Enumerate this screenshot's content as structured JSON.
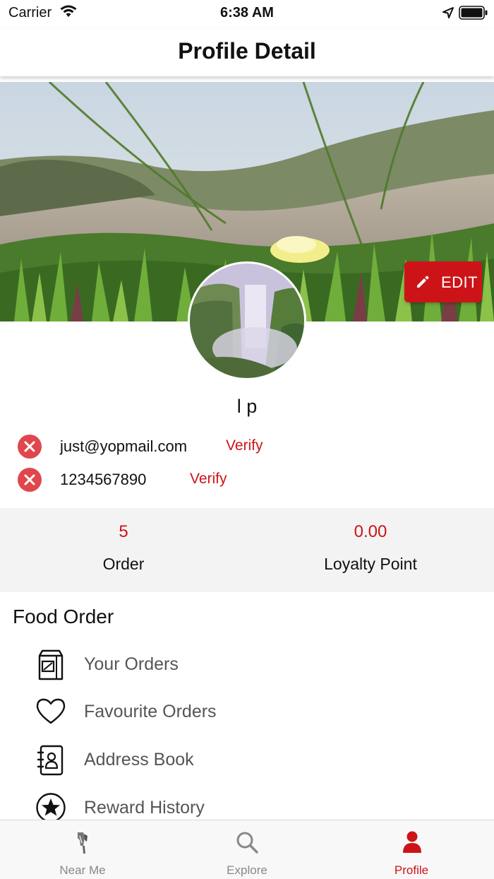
{
  "status_bar": {
    "carrier": "Carrier",
    "time": "6:38 AM"
  },
  "nav": {
    "title": "Profile Detail"
  },
  "cover": {
    "edit_label": "EDIT"
  },
  "user": {
    "name": "l p"
  },
  "contacts": [
    {
      "value": "just@yopmail.com",
      "action": "Verify",
      "verified": false
    },
    {
      "value": "1234567890",
      "action": "Verify",
      "verified": false
    }
  ],
  "stats": [
    {
      "value": "5",
      "label": "Order"
    },
    {
      "value": "0.00",
      "label": "Loyalty Point"
    }
  ],
  "section": {
    "title": "Food Order"
  },
  "menu": [
    {
      "label": "Your Orders",
      "icon": "shopping-bag-icon"
    },
    {
      "label": "Favourite Orders",
      "icon": "heart-icon"
    },
    {
      "label": "Address Book",
      "icon": "address-book-icon"
    },
    {
      "label": "Reward History",
      "icon": "star-badge-icon"
    }
  ],
  "tabs": [
    {
      "label": "Near Me",
      "icon": "near-me-icon",
      "active": false
    },
    {
      "label": "Explore",
      "icon": "search-icon",
      "active": false
    },
    {
      "label": "Profile",
      "icon": "person-icon",
      "active": true
    }
  ],
  "colors": {
    "accent": "#cc1418",
    "unverified": "#e0474c",
    "stats_background": "#f3f3f3",
    "tab_inactive": "#888888"
  }
}
